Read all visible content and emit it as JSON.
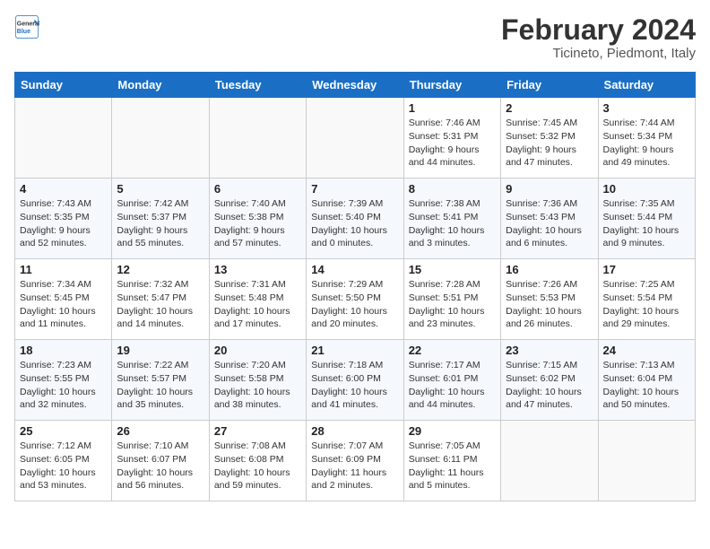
{
  "header": {
    "logo_line1": "General",
    "logo_line2": "Blue",
    "month": "February 2024",
    "location": "Ticineto, Piedmont, Italy"
  },
  "weekdays": [
    "Sunday",
    "Monday",
    "Tuesday",
    "Wednesday",
    "Thursday",
    "Friday",
    "Saturday"
  ],
  "weeks": [
    [
      {
        "day": "",
        "info": ""
      },
      {
        "day": "",
        "info": ""
      },
      {
        "day": "",
        "info": ""
      },
      {
        "day": "",
        "info": ""
      },
      {
        "day": "1",
        "info": "Sunrise: 7:46 AM\nSunset: 5:31 PM\nDaylight: 9 hours\nand 44 minutes."
      },
      {
        "day": "2",
        "info": "Sunrise: 7:45 AM\nSunset: 5:32 PM\nDaylight: 9 hours\nand 47 minutes."
      },
      {
        "day": "3",
        "info": "Sunrise: 7:44 AM\nSunset: 5:34 PM\nDaylight: 9 hours\nand 49 minutes."
      }
    ],
    [
      {
        "day": "4",
        "info": "Sunrise: 7:43 AM\nSunset: 5:35 PM\nDaylight: 9 hours\nand 52 minutes."
      },
      {
        "day": "5",
        "info": "Sunrise: 7:42 AM\nSunset: 5:37 PM\nDaylight: 9 hours\nand 55 minutes."
      },
      {
        "day": "6",
        "info": "Sunrise: 7:40 AM\nSunset: 5:38 PM\nDaylight: 9 hours\nand 57 minutes."
      },
      {
        "day": "7",
        "info": "Sunrise: 7:39 AM\nSunset: 5:40 PM\nDaylight: 10 hours\nand 0 minutes."
      },
      {
        "day": "8",
        "info": "Sunrise: 7:38 AM\nSunset: 5:41 PM\nDaylight: 10 hours\nand 3 minutes."
      },
      {
        "day": "9",
        "info": "Sunrise: 7:36 AM\nSunset: 5:43 PM\nDaylight: 10 hours\nand 6 minutes."
      },
      {
        "day": "10",
        "info": "Sunrise: 7:35 AM\nSunset: 5:44 PM\nDaylight: 10 hours\nand 9 minutes."
      }
    ],
    [
      {
        "day": "11",
        "info": "Sunrise: 7:34 AM\nSunset: 5:45 PM\nDaylight: 10 hours\nand 11 minutes."
      },
      {
        "day": "12",
        "info": "Sunrise: 7:32 AM\nSunset: 5:47 PM\nDaylight: 10 hours\nand 14 minutes."
      },
      {
        "day": "13",
        "info": "Sunrise: 7:31 AM\nSunset: 5:48 PM\nDaylight: 10 hours\nand 17 minutes."
      },
      {
        "day": "14",
        "info": "Sunrise: 7:29 AM\nSunset: 5:50 PM\nDaylight: 10 hours\nand 20 minutes."
      },
      {
        "day": "15",
        "info": "Sunrise: 7:28 AM\nSunset: 5:51 PM\nDaylight: 10 hours\nand 23 minutes."
      },
      {
        "day": "16",
        "info": "Sunrise: 7:26 AM\nSunset: 5:53 PM\nDaylight: 10 hours\nand 26 minutes."
      },
      {
        "day": "17",
        "info": "Sunrise: 7:25 AM\nSunset: 5:54 PM\nDaylight: 10 hours\nand 29 minutes."
      }
    ],
    [
      {
        "day": "18",
        "info": "Sunrise: 7:23 AM\nSunset: 5:55 PM\nDaylight: 10 hours\nand 32 minutes."
      },
      {
        "day": "19",
        "info": "Sunrise: 7:22 AM\nSunset: 5:57 PM\nDaylight: 10 hours\nand 35 minutes."
      },
      {
        "day": "20",
        "info": "Sunrise: 7:20 AM\nSunset: 5:58 PM\nDaylight: 10 hours\nand 38 minutes."
      },
      {
        "day": "21",
        "info": "Sunrise: 7:18 AM\nSunset: 6:00 PM\nDaylight: 10 hours\nand 41 minutes."
      },
      {
        "day": "22",
        "info": "Sunrise: 7:17 AM\nSunset: 6:01 PM\nDaylight: 10 hours\nand 44 minutes."
      },
      {
        "day": "23",
        "info": "Sunrise: 7:15 AM\nSunset: 6:02 PM\nDaylight: 10 hours\nand 47 minutes."
      },
      {
        "day": "24",
        "info": "Sunrise: 7:13 AM\nSunset: 6:04 PM\nDaylight: 10 hours\nand 50 minutes."
      }
    ],
    [
      {
        "day": "25",
        "info": "Sunrise: 7:12 AM\nSunset: 6:05 PM\nDaylight: 10 hours\nand 53 minutes."
      },
      {
        "day": "26",
        "info": "Sunrise: 7:10 AM\nSunset: 6:07 PM\nDaylight: 10 hours\nand 56 minutes."
      },
      {
        "day": "27",
        "info": "Sunrise: 7:08 AM\nSunset: 6:08 PM\nDaylight: 10 hours\nand 59 minutes."
      },
      {
        "day": "28",
        "info": "Sunrise: 7:07 AM\nSunset: 6:09 PM\nDaylight: 11 hours\nand 2 minutes."
      },
      {
        "day": "29",
        "info": "Sunrise: 7:05 AM\nSunset: 6:11 PM\nDaylight: 11 hours\nand 5 minutes."
      },
      {
        "day": "",
        "info": ""
      },
      {
        "day": "",
        "info": ""
      }
    ]
  ]
}
